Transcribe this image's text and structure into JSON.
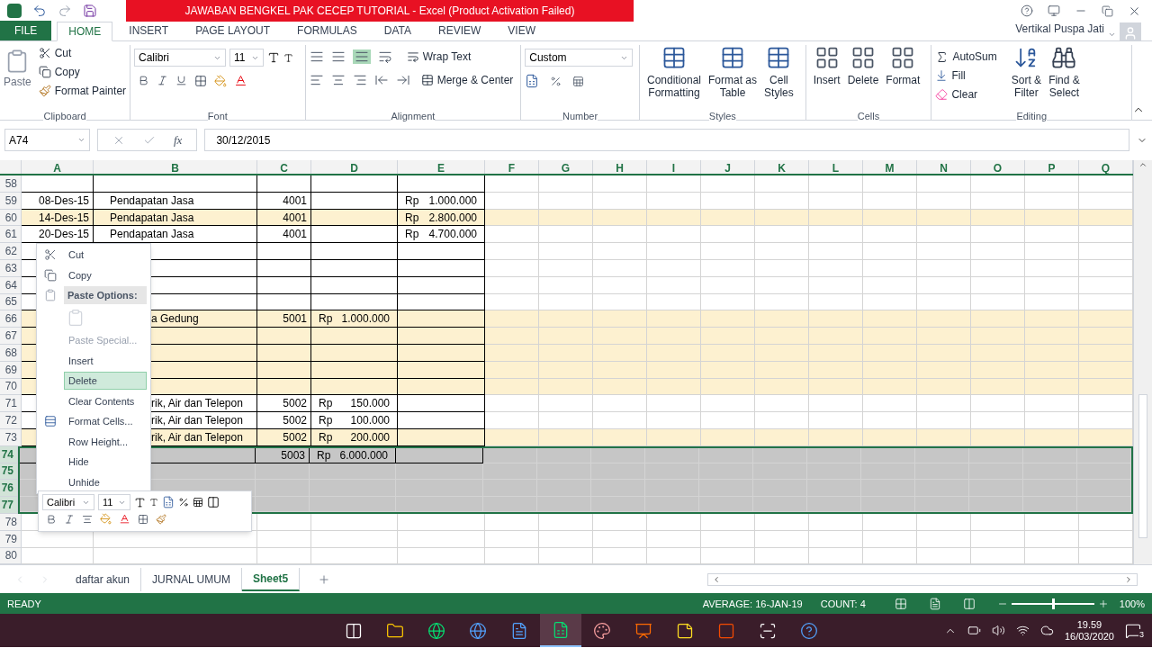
{
  "title_bar": {
    "title": "JAWABAN BENGKEL PAK CECEP TUTORIAL -  Excel (Product Activation Failed)",
    "user": "Vertikal Puspa Jati"
  },
  "ribbon_tabs": [
    {
      "label": "FILE",
      "kind": "file",
      "selected": false
    },
    {
      "label": "HOME",
      "kind": "tab",
      "selected": true
    },
    {
      "label": "INSERT",
      "kind": "tab",
      "selected": false
    },
    {
      "label": "PAGE LAYOUT",
      "kind": "tab",
      "selected": false
    },
    {
      "label": "FORMULAS",
      "kind": "tab",
      "selected": false
    },
    {
      "label": "DATA",
      "kind": "tab",
      "selected": false
    },
    {
      "label": "REVIEW",
      "kind": "tab",
      "selected": false
    },
    {
      "label": "VIEW",
      "kind": "tab",
      "selected": false
    }
  ],
  "ribbon": {
    "clipboard": {
      "label": "Clipboard",
      "paste": "Paste",
      "cut": "Cut",
      "copy": "Copy",
      "format_painter": "Format Painter"
    },
    "font": {
      "label": "Font",
      "font_name": "Calibri",
      "font_size": "11"
    },
    "alignment": {
      "label": "Alignment",
      "wrap": "Wrap Text",
      "merge": "Merge & Center"
    },
    "number": {
      "label": "Number",
      "format": "Custom"
    },
    "styles": {
      "label": "Styles",
      "buttons": [
        [
          "Conditional",
          "Formatting"
        ],
        [
          "Format as",
          "Table"
        ],
        [
          "Cell",
          "Styles"
        ]
      ]
    },
    "cells": {
      "label": "Cells",
      "buttons": [
        "Insert",
        "Delete",
        "Format"
      ]
    },
    "editing": {
      "label": "Editing",
      "autosum": "AutoSum",
      "fill": "Fill",
      "clear": "Clear",
      "sort": [
        "Sort &",
        "Filter"
      ],
      "find": [
        "Find &",
        "Select"
      ]
    }
  },
  "formula_bar": {
    "name_box": "A74",
    "function_label": "fx",
    "value": "30/12/2015"
  },
  "columns": [
    "A",
    "B",
    "C",
    "D",
    "E",
    "F",
    "G",
    "H",
    "I",
    "J",
    "K",
    "L",
    "M",
    "N",
    "O",
    "P",
    "Q"
  ],
  "rows": [
    {
      "number": "58",
      "kind": "table",
      "highlighted": false,
      "selected": false,
      "cells": {}
    },
    {
      "number": "59",
      "kind": "table",
      "highlighted": false,
      "selected": false,
      "cells": {
        "a": "08-Des-15",
        "b": "Pendapatan Jasa",
        "c": "4001",
        "e": [
          "Rp",
          "1.000.000"
        ]
      }
    },
    {
      "number": "60",
      "kind": "table",
      "highlighted": true,
      "selected": false,
      "cells": {
        "a": "14-Des-15",
        "b": "Pendapatan Jasa",
        "c": "4001",
        "e": [
          "Rp",
          "2.800.000"
        ]
      }
    },
    {
      "number": "61",
      "kind": "table",
      "highlighted": false,
      "selected": false,
      "cells": {
        "a": "20-Des-15",
        "b": "Pendapatan Jasa",
        "c": "4001",
        "e": [
          "Rp",
          "4.700.000"
        ]
      }
    },
    {
      "number": "62",
      "kind": "table",
      "highlighted": false,
      "selected": false,
      "cells": {}
    },
    {
      "number": "63",
      "kind": "table",
      "highlighted": false,
      "selected": false,
      "cells": {}
    },
    {
      "number": "64",
      "kind": "table",
      "highlighted": false,
      "selected": false,
      "cells": {}
    },
    {
      "number": "65",
      "kind": "table",
      "highlighted": false,
      "selected": false,
      "cells": {}
    },
    {
      "number": "66",
      "kind": "table",
      "highlighted": true,
      "selected": false,
      "cells": {
        "b": "a Gedung",
        "c": "5001",
        "d": [
          "Rp",
          "1.000.000"
        ]
      }
    },
    {
      "number": "67",
      "kind": "table",
      "highlighted": true,
      "selected": false,
      "cells": {}
    },
    {
      "number": "68",
      "kind": "table",
      "highlighted": true,
      "selected": false,
      "cells": {}
    },
    {
      "number": "69",
      "kind": "table",
      "highlighted": true,
      "selected": false,
      "cells": {}
    },
    {
      "number": "70",
      "kind": "table",
      "highlighted": true,
      "selected": false,
      "cells": {}
    },
    {
      "number": "71",
      "kind": "table",
      "highlighted": false,
      "selected": false,
      "cells": {
        "b": "rik, Air dan Telepon",
        "c": "5002",
        "d": [
          "Rp",
          "150.000"
        ]
      }
    },
    {
      "number": "72",
      "kind": "table",
      "highlighted": false,
      "selected": false,
      "cells": {
        "b": "rik, Air dan Telepon",
        "c": "5002",
        "d": [
          "Rp",
          "100.000"
        ]
      }
    },
    {
      "number": "73",
      "kind": "table",
      "highlighted": true,
      "selected": false,
      "cells": {
        "b": "rik, Air dan Telepon",
        "c": "5002",
        "d": [
          "Rp",
          "200.000"
        ]
      }
    },
    {
      "number": "74",
      "kind": "table",
      "highlighted": false,
      "selected": true,
      "cells": {
        "c": "5003",
        "d": [
          "Rp",
          "6.000.000"
        ]
      }
    },
    {
      "number": "75",
      "kind": "blank",
      "highlighted": false,
      "selected": true,
      "cells": {}
    },
    {
      "number": "76",
      "kind": "blank",
      "highlighted": false,
      "selected": true,
      "cells": {}
    },
    {
      "number": "77",
      "kind": "blank",
      "highlighted": false,
      "selected": true,
      "cells": {}
    },
    {
      "number": "78",
      "kind": "blank",
      "highlighted": false,
      "selected": false,
      "cells": {}
    },
    {
      "number": "79",
      "kind": "blank",
      "highlighted": false,
      "selected": false,
      "cells": {}
    },
    {
      "number": "80",
      "kind": "blank",
      "highlighted": false,
      "selected": false,
      "cells": {}
    }
  ],
  "context_menu": [
    {
      "kind": "cut",
      "label": "Cut",
      "disabled": false,
      "selected": false
    },
    {
      "kind": "copy",
      "label": "Copy",
      "disabled": false,
      "selected": false
    },
    {
      "kind": "header",
      "label": "Paste Options:",
      "disabled": false,
      "selected": false
    },
    {
      "kind": "paste_icon",
      "disabled": true,
      "selected": false
    },
    {
      "kind": "item",
      "label": "Paste Special...",
      "disabled": true,
      "selected": false
    },
    {
      "kind": "item",
      "label": "Insert",
      "disabled": false,
      "selected": false
    },
    {
      "kind": "item",
      "label": "Delete",
      "disabled": false,
      "selected": true
    },
    {
      "kind": "item",
      "label": "Clear Contents",
      "disabled": false,
      "selected": false
    },
    {
      "kind": "format",
      "label": "Format Cells...",
      "disabled": false,
      "selected": false
    },
    {
      "kind": "item",
      "label": "Row Height...",
      "disabled": false,
      "selected": false
    },
    {
      "kind": "item",
      "label": "Hide",
      "disabled": false,
      "selected": false
    },
    {
      "kind": "item",
      "label": "Unhide",
      "disabled": false,
      "selected": false
    }
  ],
  "mini_toolbar": {
    "font_name": "Calibri",
    "font_size": "11"
  },
  "sheet_tabs": [
    {
      "label": "daftar akun",
      "selected": false
    },
    {
      "label": "JURNAL UMUM",
      "selected": false
    },
    {
      "label": "Sheet5",
      "selected": true
    }
  ],
  "status_bar": {
    "mode": "READY",
    "average": "AVERAGE: 16-JAN-19",
    "count": "COUNT: 4",
    "zoom": "100%",
    "level": 0.5
  },
  "taskbar": {
    "apps": [
      {
        "kind": "taskview",
        "selected": false
      },
      {
        "kind": "folder",
        "selected": false
      },
      {
        "kind": "browser",
        "selected": false
      },
      {
        "kind": "edge",
        "selected": false
      },
      {
        "kind": "word",
        "selected": false
      },
      {
        "kind": "excel",
        "selected": true
      },
      {
        "kind": "paint",
        "selected": false
      },
      {
        "kind": "powerpoint",
        "selected": false
      },
      {
        "kind": "notes",
        "selected": false
      },
      {
        "kind": "office",
        "selected": false
      },
      {
        "kind": "snip",
        "selected": false
      },
      {
        "kind": "help",
        "selected": false
      }
    ],
    "time": "19.59",
    "date": "16/03/2020",
    "notifications": "3"
  }
}
